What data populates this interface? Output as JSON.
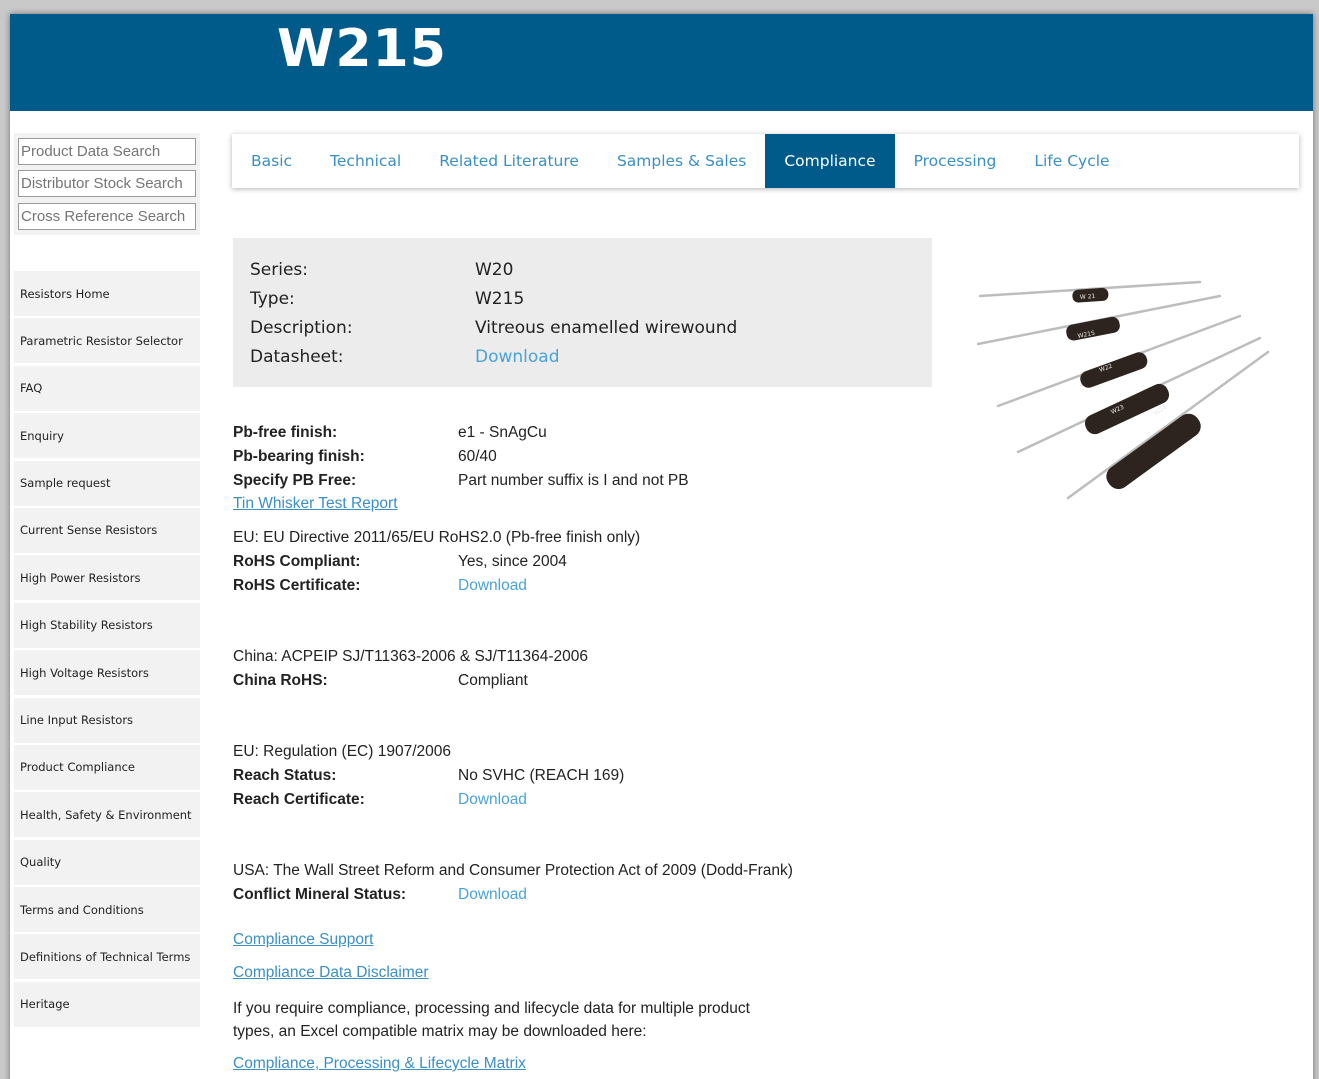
{
  "header": {
    "title": "W215"
  },
  "search": [
    {
      "placeholder": "Product Data Search"
    },
    {
      "placeholder": "Distributor Stock Search"
    },
    {
      "placeholder": "Cross Reference Search"
    }
  ],
  "sidebar": {
    "items": [
      {
        "label": "Resistors Home"
      },
      {
        "label": "Parametric Resistor Selector"
      },
      {
        "label": "FAQ"
      },
      {
        "label": "Enquiry"
      },
      {
        "label": "Sample request"
      },
      {
        "label": "Current Sense Resistors"
      },
      {
        "label": "High Power Resistors"
      },
      {
        "label": "High Stability Resistors"
      },
      {
        "label": "High Voltage Resistors"
      },
      {
        "label": "Line Input Resistors"
      },
      {
        "label": "Product Compliance"
      },
      {
        "label": "Health, Safety & Environment"
      },
      {
        "label": "Quality"
      },
      {
        "label": "Terms and Conditions"
      },
      {
        "label": "Definitions of Technical Terms"
      },
      {
        "label": "Heritage"
      }
    ]
  },
  "tabs": [
    {
      "label": "Basic"
    },
    {
      "label": "Technical"
    },
    {
      "label": "Related Literature"
    },
    {
      "label": "Samples & Sales"
    },
    {
      "label": "Compliance",
      "active": true
    },
    {
      "label": "Processing"
    },
    {
      "label": "Life Cycle"
    }
  ],
  "series": {
    "series_label": "Series:",
    "series_value": "W20",
    "type_label": "Type:",
    "type_value": "W215",
    "description_label": "Description:",
    "description_value": "Vitreous enamelled wirewound",
    "datasheet_label": "Datasheet:",
    "datasheet_link": "Download"
  },
  "compliance": {
    "pb_free_label": "Pb-free finish:",
    "pb_free_value": "e1 - SnAgCu",
    "pb_bearing_label": "Pb-bearing finish:",
    "pb_bearing_value": "60/40",
    "specify_pb_label": "Specify PB Free:",
    "specify_pb_value": "Part number suffix is I and not PB",
    "tin_whisker_link": "Tin Whisker Test Report",
    "eu_directive": "EU: EU Directive 2011/65/EU RoHS2.0 (Pb-free finish only)",
    "rohs_compliant_label": "RoHS Compliant:",
    "rohs_compliant_value": "Yes, since 2004",
    "rohs_cert_label": "RoHS Certificate:",
    "rohs_cert_link": "Download",
    "china_heading": "China: ACPEIP SJ/T11363-2006 & SJ/T11364-2006",
    "china_rohs_label": "China RoHS:",
    "china_rohs_value": "Compliant",
    "eu_regulation": "EU: Regulation (EC) 1907/2006",
    "reach_status_label": "Reach Status:",
    "reach_status_value": "No SVHC (REACH 169)",
    "reach_cert_label": "Reach Certificate:",
    "reach_cert_link": "Download",
    "usa_heading": "USA: The Wall Street Reform and Consumer Protection Act of 2009 (Dodd-Frank)",
    "conflict_label": "Conflict Mineral Status:",
    "conflict_link": "Download",
    "support_link": "Compliance Support",
    "disclaimer_link": "Compliance Data Disclaimer",
    "matrix_text": "If you require compliance, processing and lifecycle data for multiple product types, an Excel compatible matrix may be downloaded here:",
    "matrix_link": "Compliance, Processing & Lifecycle Matrix"
  },
  "product_image": {
    "resistor_labels": [
      "W 21",
      "W21S",
      "W22",
      "W23",
      "W24"
    ]
  },
  "colors": {
    "brand": "#005b8a",
    "link": "#3a8fc4",
    "panel": "#ececec"
  }
}
